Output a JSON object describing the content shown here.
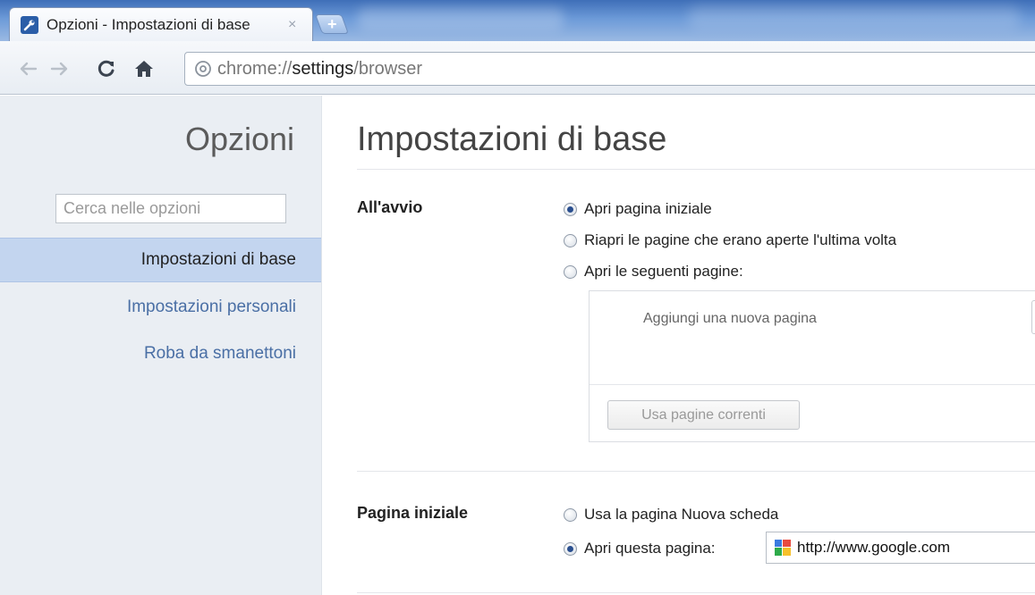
{
  "browser": {
    "tab": {
      "title": "Opzioni - Impostazioni di base",
      "close_glyph": "×",
      "favicon": "wrench-icon"
    },
    "new_tab_glyph": "+",
    "address_bar": {
      "url_prefix": "chrome://",
      "url_host": "settings",
      "url_path": "/browser"
    }
  },
  "sidebar": {
    "title": "Opzioni",
    "search_placeholder": "Cerca nelle opzioni",
    "items": [
      {
        "label": "Impostazioni di base",
        "active": true
      },
      {
        "label": "Impostazioni personali",
        "active": false
      },
      {
        "label": "Roba da smanettoni",
        "active": false
      }
    ]
  },
  "main": {
    "title": "Impostazioni di base",
    "startup": {
      "label": "All'avvio",
      "options": [
        {
          "label": "Apri pagina iniziale",
          "checked": true
        },
        {
          "label": "Riapri le pagine che erano aperte l'ultima volta",
          "checked": false
        },
        {
          "label": "Apri le seguenti pagine:",
          "checked": false
        }
      ],
      "pages_placeholder": "Aggiungi una nuova pagina",
      "use_current_button": "Usa pagine correnti"
    },
    "homepage": {
      "label": "Pagina iniziale",
      "options": [
        {
          "label": "Usa la pagina Nuova scheda",
          "checked": false
        },
        {
          "label": "Apri questa pagina:",
          "checked": true
        }
      ],
      "url_value": "http://www.google.com"
    }
  },
  "colors": {
    "accent_link": "#4a6fa5",
    "sidebar_bg": "#eaeef3",
    "sidebar_active_bg": "#c3d5ef",
    "tabstrip": "#5b86c8"
  }
}
